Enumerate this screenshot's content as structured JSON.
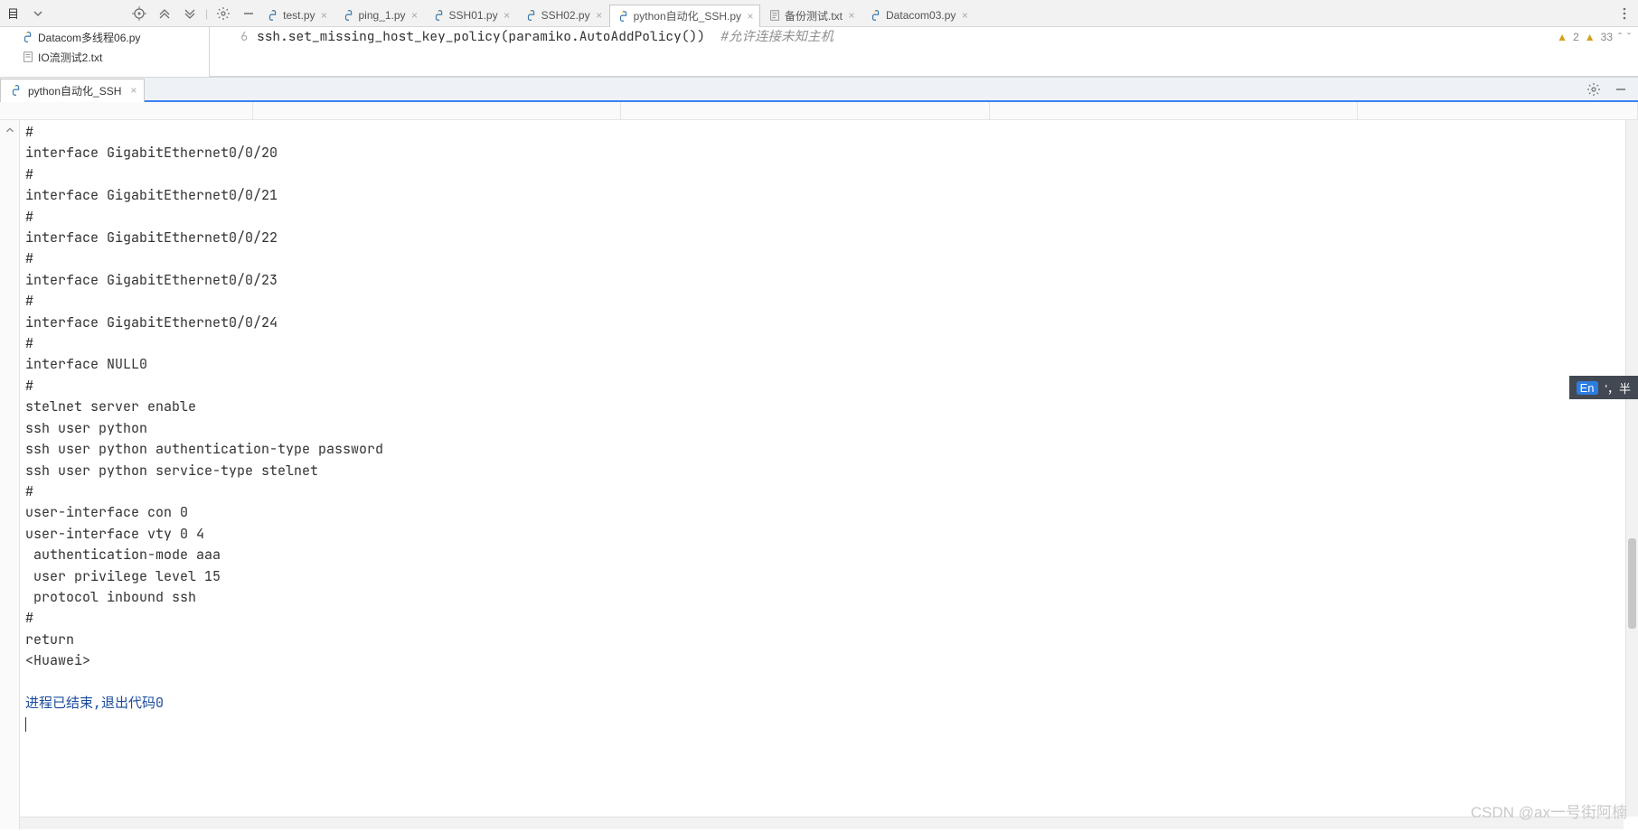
{
  "toolbar_top": {
    "project_label": "目"
  },
  "editor_tabs": [
    {
      "label": "test.py",
      "active": false,
      "kind": "py"
    },
    {
      "label": "ping_1.py",
      "active": false,
      "kind": "py"
    },
    {
      "label": "SSH01.py",
      "active": false,
      "kind": "py"
    },
    {
      "label": "SSH02.py",
      "active": false,
      "kind": "py"
    },
    {
      "label": "python自动化_SSH.py",
      "active": true,
      "kind": "py"
    },
    {
      "label": "备份测试.txt",
      "active": false,
      "kind": "txt"
    },
    {
      "label": "Datacom03.py",
      "active": false,
      "kind": "py"
    }
  ],
  "project_files": [
    {
      "label": "Datacom多线程06.py",
      "kind": "py"
    },
    {
      "label": "IO流测试2.txt",
      "kind": "txt"
    }
  ],
  "editor": {
    "line_number": "6",
    "before_text": "ssh.set_missing_host_key_policy(paramiko.AutoAddPolicy()) ",
    "comment": " #允许连接未知主机"
  },
  "inspections": {
    "warn1_count": "2",
    "warn2_count": "33"
  },
  "console_tab_label": "python自动化_SSH",
  "console_output_text": "#\ninterface GigabitEthernet0/0/20\n#\ninterface GigabitEthernet0/0/21\n#\ninterface GigabitEthernet0/0/22\n#\ninterface GigabitEthernet0/0/23\n#\ninterface GigabitEthernet0/0/24\n#\ninterface NULL0\n#\nstelnet server enable\nssh user python\nssh user python authentication-type password\nssh user python service-type stelnet\n#\nuser-interface con 0\nuser-interface vty 0 4\n authentication-mode aaa\n user privilege level 15\n protocol inbound ssh\n#\nreturn\n<Huawei>\n",
  "console_exit_text": "进程已结束,退出代码0",
  "ime": {
    "badge": "En",
    "text": "'，半"
  },
  "watermark_text": "CSDN @ax一号街阿楠"
}
